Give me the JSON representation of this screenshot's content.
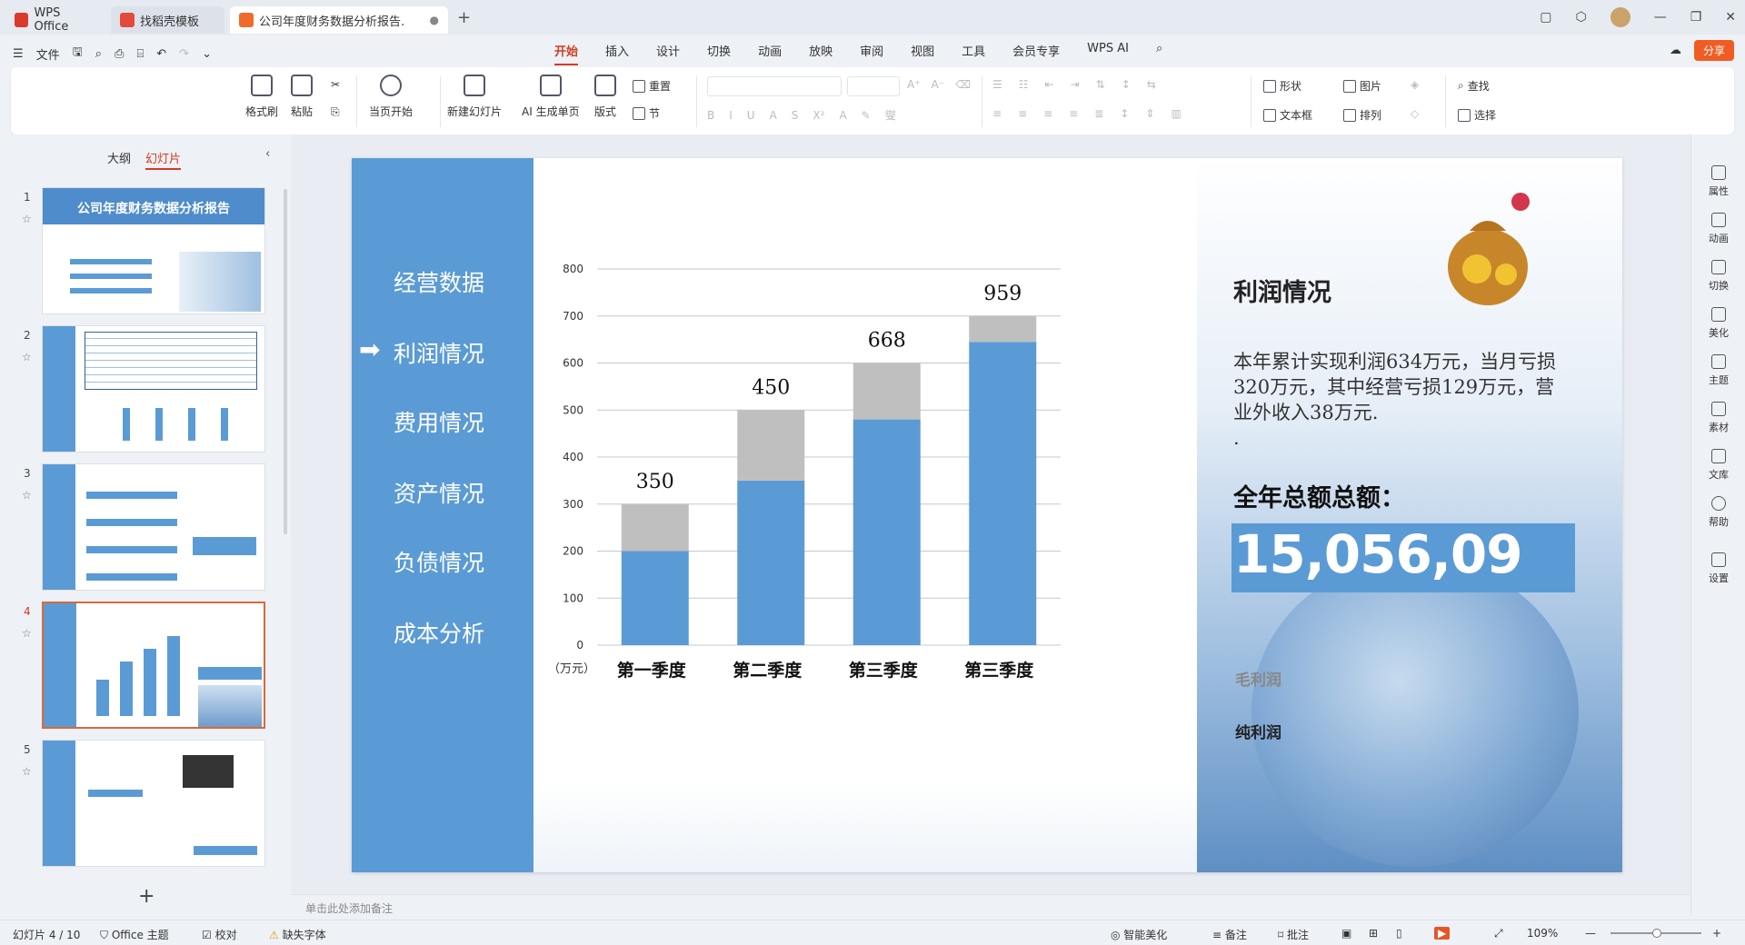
{
  "titlebar": {
    "tabs": [
      {
        "label": "WPS Office"
      },
      {
        "label": "找稻壳模板"
      },
      {
        "label": "公司年度财务数据分析报告.p"
      }
    ]
  },
  "menubar": {
    "file": "文件",
    "tabs": [
      "开始",
      "插入",
      "设计",
      "切换",
      "动画",
      "放映",
      "审阅",
      "视图",
      "工具",
      "会员专享",
      "WPS AI"
    ],
    "share": "分享"
  },
  "ribbon": {
    "format_painter": "格式刷",
    "paste": "粘贴",
    "play_from_current": "当页开始",
    "new_slide": "新建幻灯片",
    "ai_slide": "AI 生成单页",
    "layout": "版式",
    "reset": "重置",
    "section": "节",
    "shape": "形状",
    "picture": "图片",
    "find": "查找",
    "textbox": "文本框",
    "arrange": "排列",
    "select": "选择"
  },
  "left_panel": {
    "tab_outline": "大纲",
    "tab_slides": "幻灯片",
    "slides": [
      {
        "num": "1",
        "title": "公司年度财务数据分析报告"
      },
      {
        "num": "2"
      },
      {
        "num": "3"
      },
      {
        "num": "4"
      },
      {
        "num": "5"
      }
    ]
  },
  "slide": {
    "nav": [
      "经营数据",
      "利润情况",
      "费用情况",
      "资产情况",
      "负债情况",
      "成本分析"
    ],
    "active_nav": "利润情况",
    "panel_title": "利润情况",
    "panel_text": "本年累计实现利润634万元，当月亏损320万元，其中经营亏损129万元，营业外收入38万元.",
    "panel_dot": ".",
    "total_label": "全年总额总额：",
    "total_value": "15,056,09",
    "legend_gross": "毛利润",
    "legend_net": "纯利润"
  },
  "chart_data": {
    "type": "bar",
    "stacked": true,
    "unit_label": "（万元）",
    "categories": [
      "第一季度",
      "第二季度",
      "第三季度",
      "第三季度"
    ],
    "totals_labels": [
      "350",
      "450",
      "668",
      "959"
    ],
    "series": [
      {
        "name": "纯利润",
        "values": [
          200,
          350,
          480,
          645
        ],
        "color": "#5b9bd5"
      },
      {
        "name": "毛利润",
        "values": [
          100,
          150,
          120,
          55
        ],
        "color": "#bfbfbf"
      }
    ],
    "ylim": [
      0,
      800
    ],
    "yticks": [
      "0",
      "100",
      "200",
      "300",
      "400",
      "500",
      "600",
      "700",
      "800"
    ],
    "grid": true
  },
  "notes": {
    "placeholder": "单击此处添加备注"
  },
  "rightbar": [
    "属性",
    "动画",
    "切换",
    "美化",
    "主题",
    "素材",
    "文库",
    "帮助",
    "设置"
  ],
  "status": {
    "slide_counter": "幻灯片 4 / 10",
    "theme": "Office 主题",
    "proof": "校对",
    "missing_font": "缺失字体",
    "beautify": "智能美化",
    "notes": "备注",
    "comments": "批注",
    "zoom": "109%"
  }
}
